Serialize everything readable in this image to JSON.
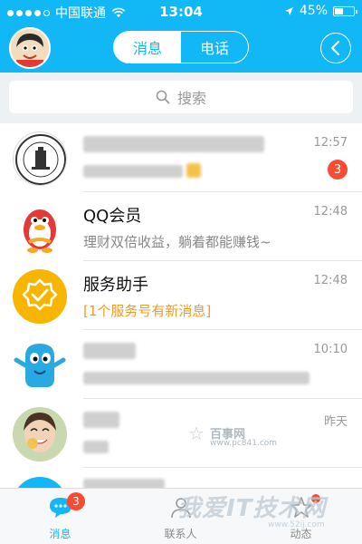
{
  "status_bar": {
    "carrier": "中国联通",
    "time": "13:04",
    "battery_text": "45%",
    "battery_level": 0.45,
    "signal_bars_filled": 4
  },
  "header": {
    "tabs": [
      {
        "label": "消息",
        "active": true
      },
      {
        "label": "电话",
        "active": false
      }
    ],
    "back_icon": "chevron-left-circle-icon",
    "avatar_icon": "cartoon-avatar-icon"
  },
  "search": {
    "placeholder": "搜索",
    "icon": "search-icon"
  },
  "conversations": [
    {
      "title": "",
      "subtitle": "",
      "time": "12:57",
      "badge": "3",
      "blurred": true,
      "avatar": "university-seal-avatar"
    },
    {
      "title": "QQ会员",
      "subtitle": "理财双倍收益，躺着都能赚钱~",
      "time": "12:48",
      "badge": "",
      "avatar": "qq-penguin-avatar"
    },
    {
      "title": "服务助手",
      "subtitle": "[1个服务号有新消息]",
      "time": "12:48",
      "badge": "",
      "avatar": "service-badge-avatar"
    },
    {
      "title": "",
      "subtitle": "",
      "time": "10:10",
      "badge": "",
      "blurred": true,
      "avatar": "blue-monster-avatar"
    },
    {
      "title": "",
      "subtitle": "",
      "time": "昨天",
      "badge": "",
      "blurred": true,
      "avatar": "person-photo-avatar"
    }
  ],
  "tabbar": {
    "tabs": [
      {
        "label": "消息",
        "active": true,
        "badge": "3",
        "icon": "chat-bubble-icon"
      },
      {
        "label": "联系人",
        "active": false,
        "icon": "person-icon"
      },
      {
        "label": "动态",
        "active": false,
        "icon": "star-icon",
        "dot": true
      }
    ]
  },
  "watermarks": {
    "site_name": "百事网",
    "site_url": "www.pc841.com",
    "site2_name": "我爱IT技术网",
    "site2_url": "www.52ij.com"
  },
  "colors": {
    "brand_blue": "#12b7f5",
    "badge_red": "#f74c31",
    "accent_orange": "#f49a1b"
  }
}
